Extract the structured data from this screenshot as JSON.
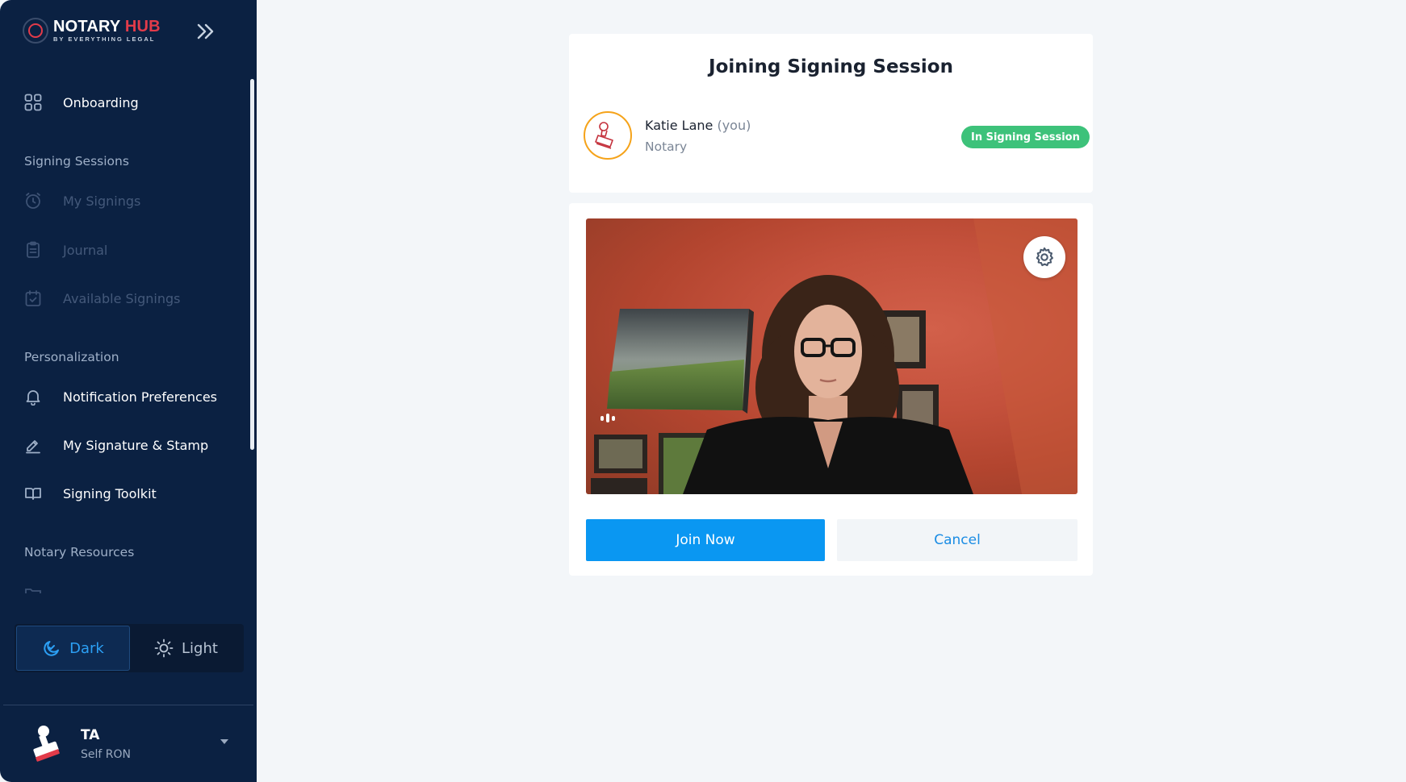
{
  "app": {
    "logo_title_main": "NOTARY",
    "logo_title_accent": "HUB",
    "logo_subtitle": "BY EVERYTHING LEGAL"
  },
  "sidebar": {
    "onboarding_label": "Onboarding",
    "sections": {
      "signing_sessions": "Signing Sessions",
      "personalization": "Personalization",
      "notary_resources": "Notary Resources"
    },
    "items": {
      "my_signings": "My Signings",
      "journal": "Journal",
      "available_signings": "Available Signings",
      "notification_preferences": "Notification Preferences",
      "signature_stamp": "My Signature & Stamp",
      "signing_toolkit": "Signing Toolkit"
    },
    "theme": {
      "dark_label": "Dark",
      "light_label": "Light",
      "selected": "Dark"
    },
    "user": {
      "initials": "TA",
      "role": "Self RON"
    }
  },
  "session": {
    "title": "Joining Signing Session",
    "participant": {
      "name": "Katie Lane",
      "you_tag": "(you)",
      "role": "Notary",
      "status": "In Signing Session"
    },
    "join_label": "Join Now",
    "cancel_label": "Cancel"
  },
  "colors": {
    "sidebar_bg": "#0b2142",
    "accent_red": "#e23b4a",
    "primary_blue": "#0a97f2",
    "status_green": "#3dc27a",
    "avatar_ring": "#f5a31a"
  }
}
